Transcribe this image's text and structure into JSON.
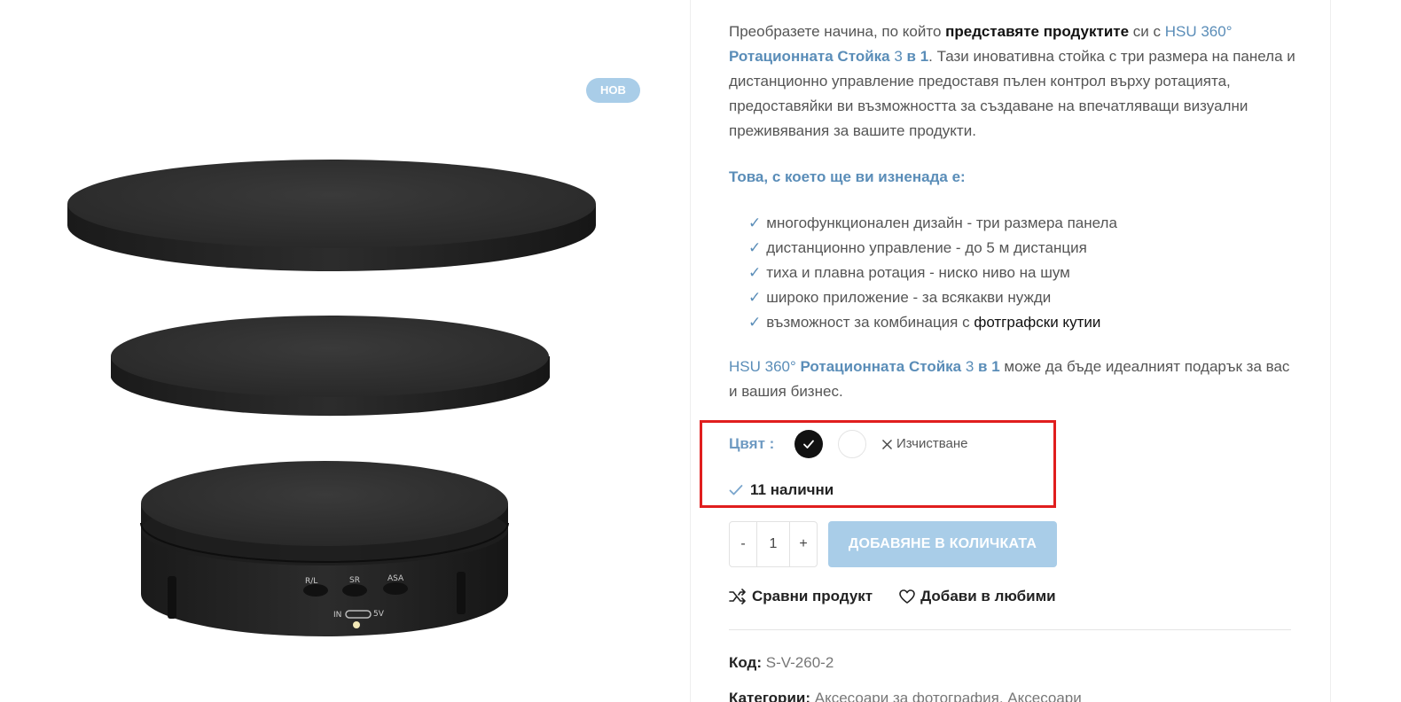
{
  "gallery": {
    "badge": "НОВ",
    "controls": {
      "rl": "R/L",
      "sr": "SR",
      "asa": "ASA",
      "in": "IN",
      "fivev": "5V"
    }
  },
  "description": {
    "p1_a": "Преобразете начина, по който ",
    "p1_b": "представяте продуктите",
    "p1_c": " си с ",
    "p1_link_a": "HSU 360° ",
    "p1_link_b": "Ротационната Стойка",
    "p1_link_c": " 3 ",
    "p1_link_d": "в 1",
    "p1_d": ". Тази иновативна стойка с три размера на панела и дистанционно управление предоставя пълен контрол върху ротацията, предоставяйки ви възможността за създаване на впечатляващи визуални преживявания за вашите продукти."
  },
  "surprise_title": "Това, с което ще ви изненада е:",
  "features": [
    {
      "check": "✓",
      "text": "многофункционален дизайн - три размера панела"
    },
    {
      "check": "✓",
      "text": "дистанционно управление - до 5 м дистанция"
    },
    {
      "check": "✓",
      "text": "тиха и плавна ротация - ниско ниво на шум"
    },
    {
      "check": "✓",
      "text": "широко приложение - за всякакви нужди"
    },
    {
      "check": "✓",
      "text": "възможност за комбинация с ",
      "dark": "фотграфски кутии"
    }
  ],
  "gift": {
    "link_a": "HSU 360° ",
    "link_b": "Ротационната Стойка",
    "link_c": " 3 ",
    "link_d": "в 1",
    "rest": " може да бъде идеалният подарък за вас и вашия бизнес."
  },
  "variation": {
    "color_label": "Цвят :",
    "clear_label": "Изчистване",
    "stock": "11 налични",
    "swatches": [
      {
        "name": "black",
        "color": "#111111",
        "selected": true
      },
      {
        "name": "white",
        "color": "#ffffff",
        "selected": false
      }
    ]
  },
  "cart": {
    "minus": "-",
    "qty": "1",
    "plus": "+",
    "add_label": "ДОБАВЯНЕ В КОЛИЧКАТА"
  },
  "actions": {
    "compare": "Сравни продукт",
    "wishlist": "Добави в любими"
  },
  "meta": {
    "sku_label": "Код:",
    "sku_value": "S-V-260-2",
    "cat_label": "Категории:",
    "cat_value": "Аксесоари за фотография, Аксесоари"
  },
  "colors": {
    "accent": "#5a8db8",
    "badge": "#a9cde8",
    "highlight": "#e01e1e"
  }
}
